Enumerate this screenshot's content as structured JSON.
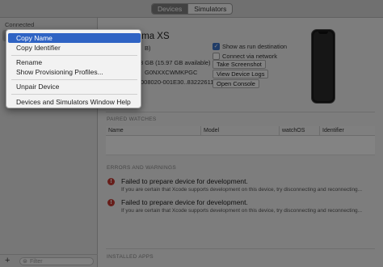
{
  "titlebar": {
    "tabs": [
      "Devices",
      "Simulators"
    ],
    "active_tab": "Devices"
  },
  "sidebar": {
    "heading": "Connected",
    "filter_placeholder": "Filter"
  },
  "device": {
    "name": "Dragonoma XS",
    "capacity_fragment": "B)",
    "available_fragment": "3 GB (15.97 GB available)",
    "serial_fragment": "G0NXXCWMKPGC",
    "identifier_fragment": "008020-001E30..8322261102E"
  },
  "options": {
    "show_as_run_destination": {
      "label": "Show as run destination",
      "checked": true
    },
    "connect_via_network": {
      "label": "Connect via network",
      "checked": false
    },
    "buttons": [
      "Take Screenshot",
      "View Device Logs",
      "Open Console"
    ]
  },
  "paired_watches": {
    "title": "PAIRED WATCHES",
    "columns": [
      "Name",
      "Model",
      "watchOS",
      "Identifier"
    ]
  },
  "errors": {
    "title": "ERRORS AND WARNINGS",
    "items": [
      {
        "title": "Failed to prepare device for development.",
        "body": "If you are certain that Xcode supports development on this device, try disconnecting and reconnecting..."
      },
      {
        "title": "Failed to prepare device for development.",
        "body": "If you are certain that Xcode supports development on this device, try disconnecting and reconnecting..."
      }
    ]
  },
  "installed_apps": {
    "title": "INSTALLED APPS"
  },
  "context_menu": {
    "items": [
      "Copy Name",
      "Copy Identifier",
      "Rename",
      "Show Provisioning Profiles...",
      "Unpair Device",
      "Devices and Simulators Window Help"
    ],
    "highlighted": "Copy Name"
  },
  "colors": {
    "accent": "#2f63c4",
    "error": "#c53a33",
    "checkbox": "#3e74c6"
  }
}
